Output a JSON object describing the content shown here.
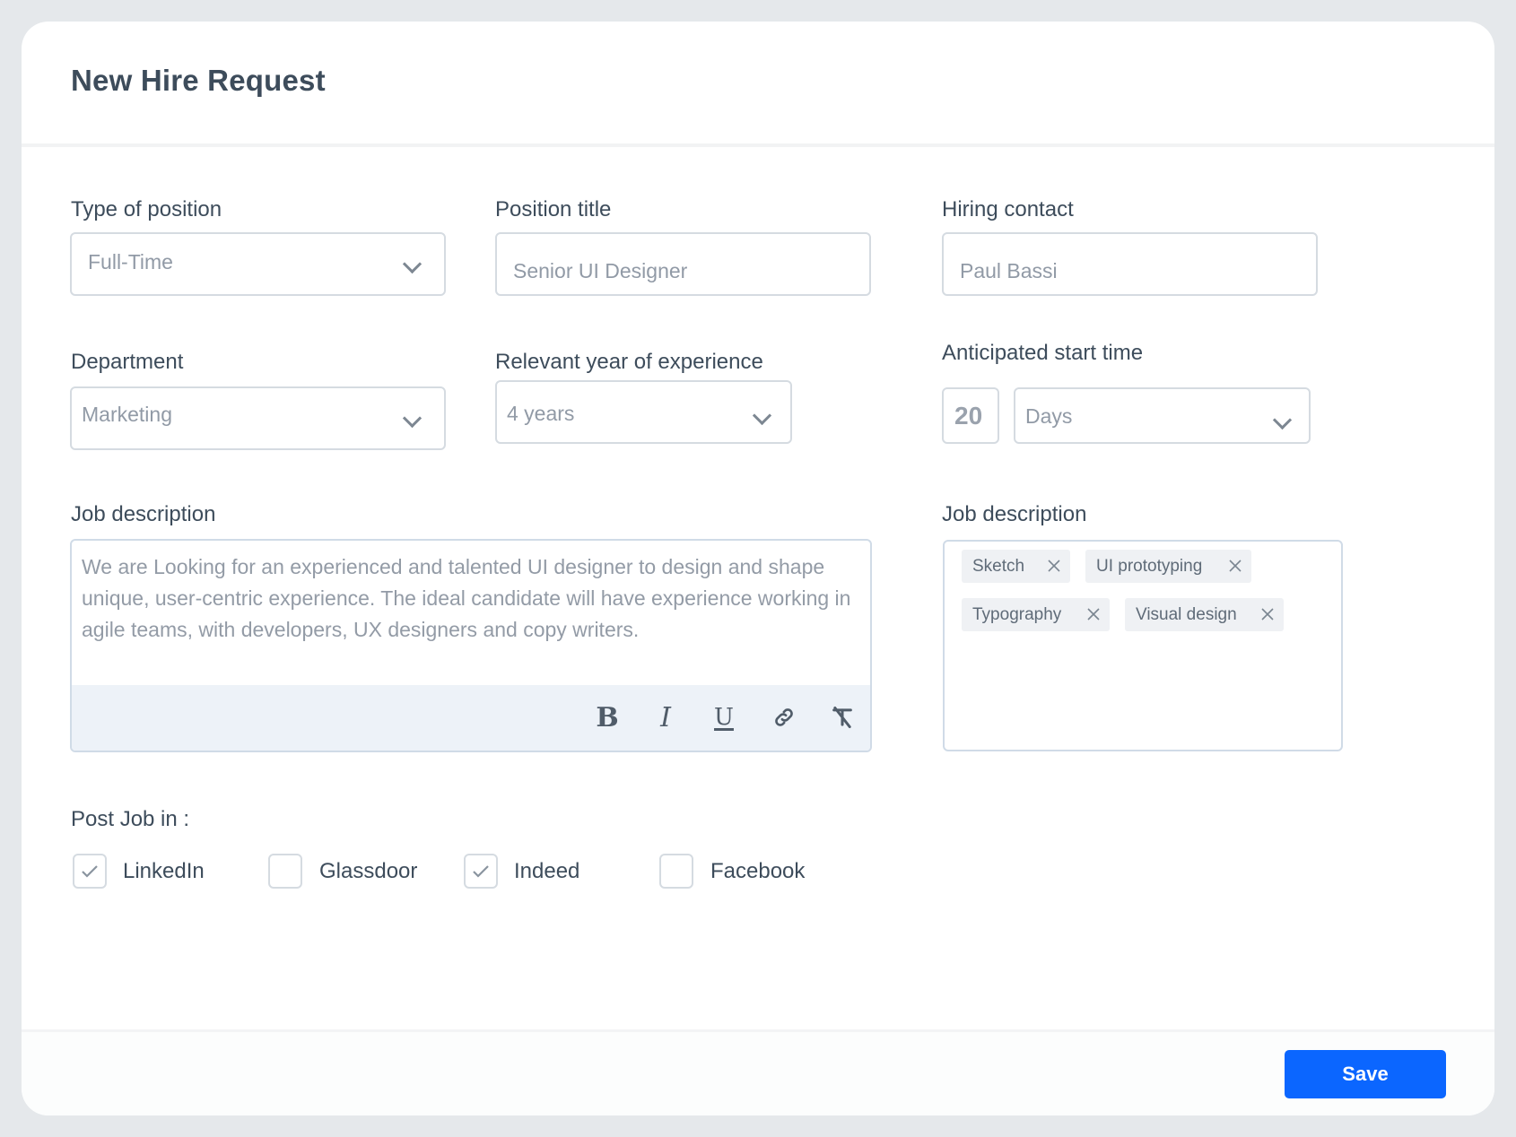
{
  "header": {
    "title": "New Hire Request"
  },
  "fields": {
    "type_of_position": {
      "label": "Type of position",
      "value": "Full-Time",
      "icon": "chevron-down-icon"
    },
    "position_title": {
      "label": "Position title",
      "placeholder": "Senior UI Designer"
    },
    "hiring_contact": {
      "label": "Hiring contact",
      "placeholder": "Paul Bassi"
    },
    "department": {
      "label": "Department",
      "value": "Marketing",
      "icon": "chevron-down-icon"
    },
    "experience": {
      "label": "Relevant year of experience",
      "value": "4 years",
      "icon": "chevron-down-icon"
    },
    "start_time": {
      "label": "Anticipated start time",
      "amount": "20",
      "unit": "Days",
      "icon": "chevron-down-icon"
    },
    "job_description": {
      "label": "Job description",
      "text": "We are Looking for an experienced and talented UI designer to design and shape unique, user-centric experience. The ideal candidate will have experience working in agile teams, with developers, UX designers and copy writers.",
      "toolbar": [
        {
          "name": "bold",
          "icon": "bold-icon",
          "glyph": "B"
        },
        {
          "name": "italic",
          "icon": "italic-icon",
          "glyph": "I"
        },
        {
          "name": "underline",
          "icon": "underline-icon",
          "glyph": "U"
        },
        {
          "name": "link",
          "icon": "link-icon",
          "glyph": "link"
        },
        {
          "name": "clear-format",
          "icon": "clear-format-icon",
          "glyph": "T"
        }
      ]
    },
    "skills": {
      "label": "Job description",
      "tags": [
        "Sketch",
        "UI prototyping",
        "Typography",
        "Visual design"
      ],
      "remove_icon": "close-icon"
    }
  },
  "post_job": {
    "label": "Post Job in :",
    "options": [
      {
        "label": "LinkedIn",
        "checked": true
      },
      {
        "label": "Glassdoor",
        "checked": false
      },
      {
        "label": "Indeed",
        "checked": true
      },
      {
        "label": "Facebook",
        "checked": false
      }
    ]
  },
  "footer": {
    "save_label": "Save"
  },
  "colors": {
    "primary": "#0b66ff",
    "frame": "#e5e8eb",
    "heading": "#3d4c5b",
    "muted_text": "#919aa6",
    "toolbar_bg": "#edf2f8",
    "tag_bg": "#eff1f4"
  }
}
